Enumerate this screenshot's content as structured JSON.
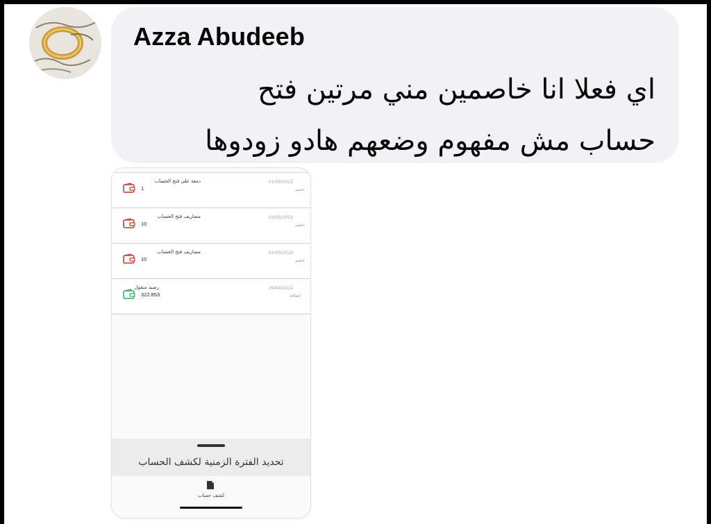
{
  "comment": {
    "author": "Azza Abudeeb",
    "message_lines": [
      "اي فعلا انا خاصمين مني مرتين فتح",
      "حساب مش مفهوم وضعهم هادو زودوها"
    ]
  },
  "avatar": {
    "icon": "ring-photo-avatar"
  },
  "statement": {
    "transactions": [
      {
        "title": "دمغة على فتح الحساب",
        "amount": "1",
        "date": "01/05/2022",
        "type": "خصم",
        "icon": "wallet-out-icon",
        "color": "#c0392b"
      },
      {
        "title": "مصاريف فتح الحساب",
        "amount": "10",
        "date": "01/05/2022",
        "type": "خصم",
        "icon": "wallet-out-icon",
        "color": "#c0392b"
      },
      {
        "title": "مصاريف فتح الحساب",
        "amount": "10",
        "date": "01/05/2022",
        "type": "خصم",
        "icon": "wallet-out-icon",
        "color": "#c0392b"
      },
      {
        "title": "رصيد منقول",
        "amount": "322.853",
        "date": "29/04/2022",
        "type": "إضافة",
        "icon": "wallet-in-icon",
        "color": "#27ae60"
      }
    ],
    "panel_title": "تحديد الفترة الزمنية لكشف الحساب",
    "nav_label": "كشف حساب",
    "nav_icon": "document-icon"
  }
}
